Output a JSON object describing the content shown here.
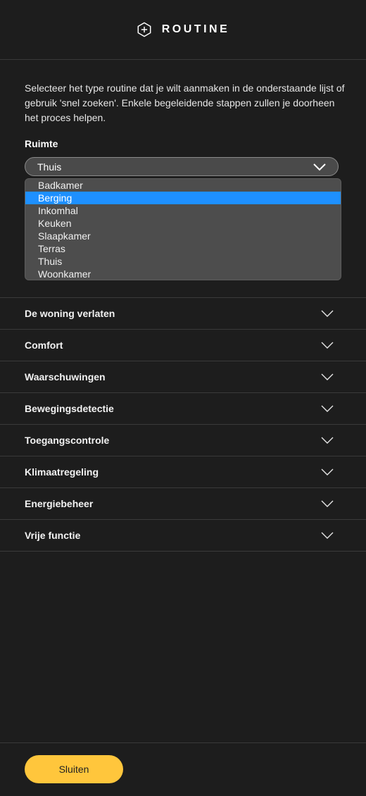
{
  "header": {
    "title": "ROUTINE",
    "icon": "add-hexagon-icon"
  },
  "intro": "Selecteer het type routine dat je wilt aanmaken in de onderstaande lijst of gebruik 'snel zoeken'. Enkele begeleidende stappen zullen je doorheen het proces helpen.",
  "room": {
    "label": "Ruimte",
    "value": "Thuis",
    "options": [
      "Badkamer",
      "Berging",
      "Inkomhal",
      "Keuken",
      "Slaapkamer",
      "Terras",
      "Thuis",
      "Woonkamer"
    ],
    "highlighted": "Berging"
  },
  "categories": [
    "De woning verlaten",
    "Comfort",
    "Waarschuwingen",
    "Bewegingsdetectie",
    "Toegangscontrole",
    "Klimaatregeling",
    "Energiebeheer",
    "Vrije functie"
  ],
  "footer": {
    "close_label": "Sluiten"
  },
  "colors": {
    "background": "#1d1d1d",
    "accent": "#ffc63c",
    "highlight": "#1e90ff"
  }
}
